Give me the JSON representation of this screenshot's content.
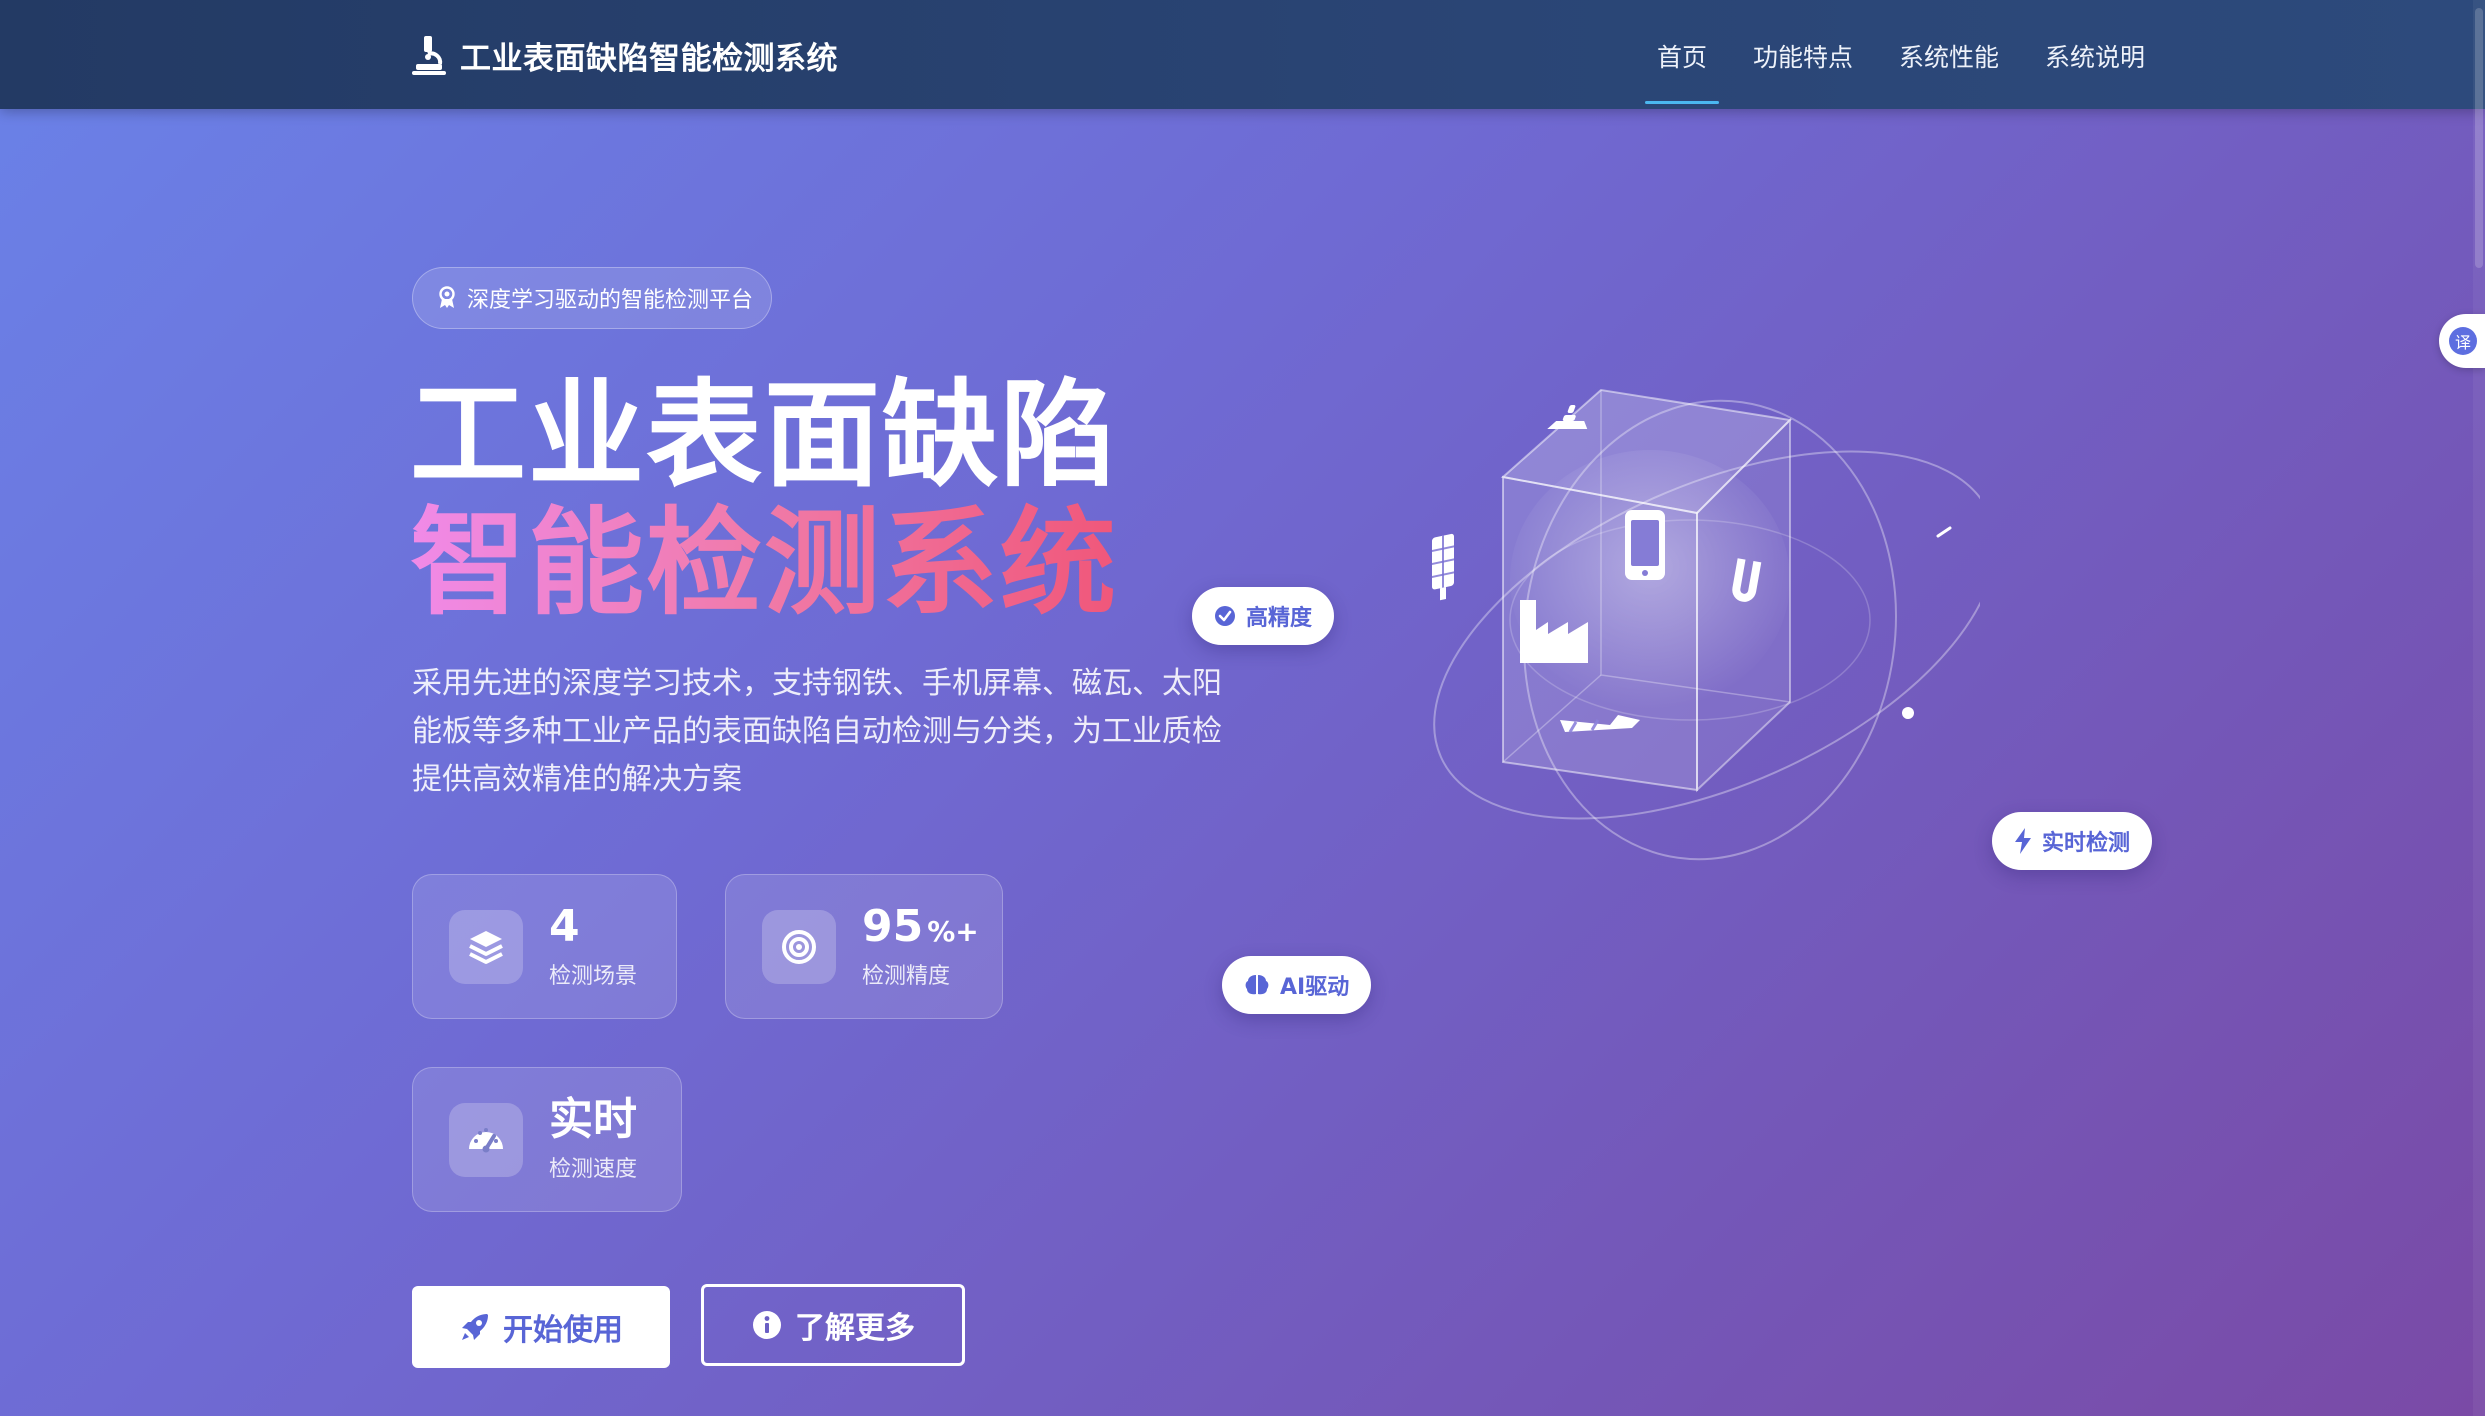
{
  "nav": {
    "brand": "工业表面缺陷智能检测系统",
    "links": [
      "首页",
      "功能特点",
      "系统性能",
      "系统说明"
    ],
    "active_link": "首页"
  },
  "hero": {
    "badge": "深度学习驱动的智能检测平台",
    "title_line1": "工业表面缺陷",
    "title_line2": "智能检测系统",
    "subtitle": "采用先进的深度学习技术，支持钢铁、手机屏幕、磁瓦、太阳能板等多种工业产品的表面缺陷自动检测与分类，为工业质检提供高效精准的解决方案"
  },
  "stats": [
    {
      "value": "4",
      "unit": "",
      "label": "检测场景",
      "icon": "layers-icon"
    },
    {
      "value": "95",
      "unit": "%+",
      "label": "检测精度",
      "icon": "target-icon"
    },
    {
      "value": "实时",
      "unit": "",
      "label": "检测速度",
      "icon": "speedometer-icon"
    }
  ],
  "buttons": {
    "primary": "开始使用",
    "secondary": "了解更多"
  },
  "floating_labels": {
    "accuracy": "高精度",
    "realtime": "实时检测",
    "ai": "AI驱动"
  },
  "translate": "译",
  "colors": {
    "nav_bg": "#233a64",
    "accent": "#5865d6",
    "nav_underline": "#4bb8f0",
    "title_gradient_start": "#f08ae8",
    "title_gradient_end": "#f0577a"
  }
}
